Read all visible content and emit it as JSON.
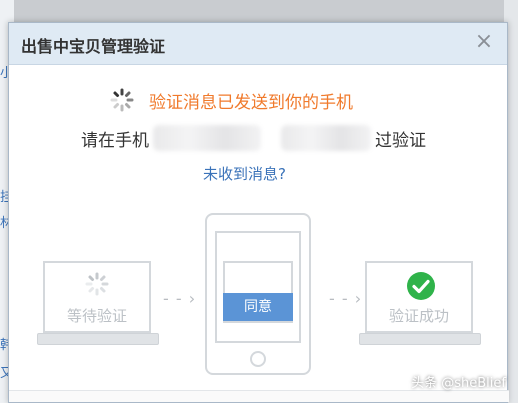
{
  "dialog": {
    "title": "出售中宝贝管理验证",
    "close_glyph": "×"
  },
  "status": {
    "message": "验证消息已发送到你的手机"
  },
  "phone_line": {
    "prefix": "请在手机",
    "suffix": "过验证"
  },
  "resend_link": "未收到消息?",
  "flow": {
    "left_label": "等待验证",
    "phone_button": "同意",
    "right_label": "验证成功",
    "arrow_glyph": "- - ›"
  },
  "watermark": "头条 @sheBlief",
  "colors": {
    "status_orange": "#f07a2c",
    "link_blue": "#3b73b9",
    "success_green": "#2fb34a",
    "agree_blue": "#5b94d6"
  }
}
